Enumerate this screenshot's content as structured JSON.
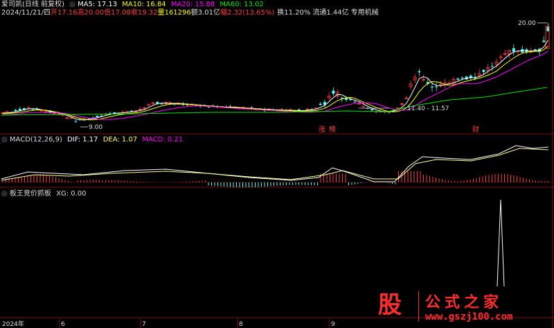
{
  "header": {
    "stock_name": "爱司凯(日线 前复权)",
    "ma5": "MA5: 17.13",
    "ma10": "MA10: 16.84",
    "ma20": "MA20: 15.88",
    "ma60": "MA60: 13.02",
    "date": "2024/11/21/四",
    "open": "开17.16",
    "high": "高20.00",
    "low": "低17.08",
    "close": "收19.32",
    "volume": "量161296",
    "amount": "额3.01亿",
    "change": "幅2.32(13.65%)",
    "turnover": "换11.20%",
    "float_cap": "流通1.44亿",
    "sector": "专用机械"
  },
  "price_panel": {
    "high_mark": "20.00",
    "low_mark": "9.00",
    "range_label": "11.40 - 11.57",
    "tags": [
      "涨",
      "榜",
      "财"
    ]
  },
  "macd": {
    "title": "MACD(12,26,9)",
    "dif": "DIF: 1.17",
    "dea": "DEA: 1.07",
    "macd": "MACD: 0.21"
  },
  "indicator": {
    "title": "板王竞价抓板",
    "xg": "XG: 0.00"
  },
  "time_axis": [
    "2024年",
    "6",
    "7",
    "8",
    "9"
  ],
  "watermark": {
    "logo": "股",
    "name": "公式之家",
    "url": "www.gszj100.com"
  },
  "colors": {
    "up": "#ff3c3c",
    "down": "#54fcfc",
    "ma5": "#ffffff",
    "ma10": "#ffff00",
    "ma20": "#ff00ff",
    "ma60": "#00e600",
    "label": "#dddddd",
    "grid": "#7a1010"
  }
}
